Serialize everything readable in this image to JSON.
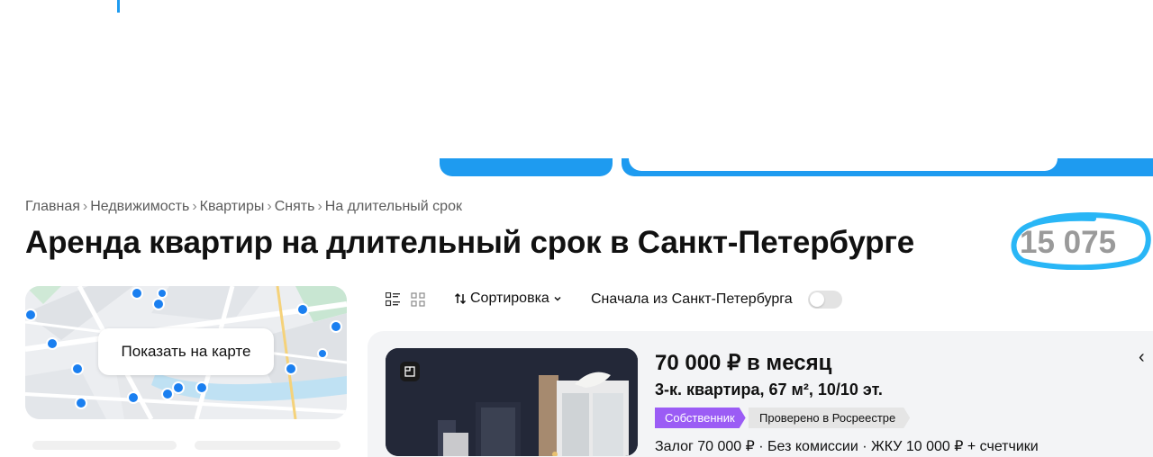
{
  "breadcrumb": [
    {
      "label": "Главная"
    },
    {
      "label": "Недвижимость"
    },
    {
      "label": "Квартиры"
    },
    {
      "label": "Снять"
    },
    {
      "label": "На длительный срок"
    }
  ],
  "breadcrumb_separator": "›",
  "page": {
    "title": "Аренда квартир на длительный срок в Санкт-Петербурге",
    "result_count": "15 075"
  },
  "map": {
    "show_on_map_label": "Показать на карте"
  },
  "toolbar": {
    "sort_label": "Сортировка",
    "city_first_label": "Сначала из Санкт-Петербурга",
    "city_first_enabled": false
  },
  "listing": {
    "price": "70 000 ₽ в месяц",
    "params": "3-к. квартира, 67 м², 10/10 эт.",
    "tags": {
      "owner": "Собственник",
      "verified": "Проверено в Росреестре"
    },
    "terms": "Залог 70 000 ₽ · Без комиссии · ЖКУ 10 000 ₽ + счетчики"
  },
  "colors": {
    "accent_blue": "#1e9bf0",
    "highlight_circle": "#29b6f6",
    "map_pin": "#1a7ff0",
    "owner_tag": "#9b5cf5",
    "card_bg": "#f3f4f6"
  }
}
